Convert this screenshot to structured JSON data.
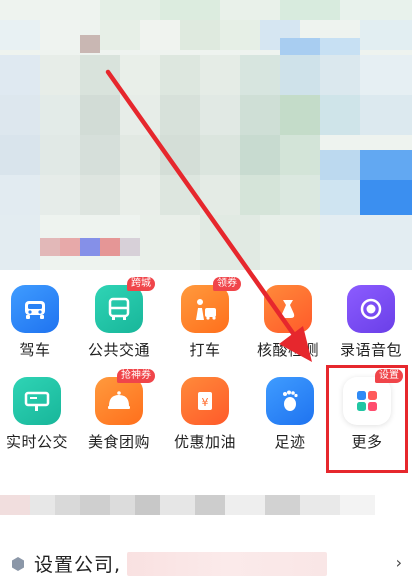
{
  "services": [
    {
      "id": "driving",
      "label": "驾车",
      "icon": "car-icon",
      "badge": ""
    },
    {
      "id": "transit",
      "label": "公共交通",
      "icon": "bus-icon",
      "badge": "跨城"
    },
    {
      "id": "taxi",
      "label": "打车",
      "icon": "taxi-person-icon",
      "badge": "领券"
    },
    {
      "id": "covid-test",
      "label": "核酸检测",
      "icon": "test-tube-icon",
      "badge": ""
    },
    {
      "id": "voice",
      "label": "录语音包",
      "icon": "record-icon",
      "badge": ""
    },
    {
      "id": "realtime-bus",
      "label": "实时公交",
      "icon": "bus-stop-icon",
      "badge": ""
    },
    {
      "id": "food",
      "label": "美食团购",
      "icon": "food-cover-icon",
      "badge": "抢神券"
    },
    {
      "id": "fuel",
      "label": "优惠加油",
      "icon": "fuel-yen-icon",
      "badge": ""
    },
    {
      "id": "footprint",
      "label": "足迹",
      "icon": "footprint-icon",
      "badge": ""
    },
    {
      "id": "more",
      "label": "更多",
      "icon": "grid-more-icon",
      "badge": "设置"
    }
  ],
  "bottom_row": {
    "company_label": "设置公司,",
    "hex_icon": "hexagon-icon",
    "chevron_icon": "chevron-right-icon"
  },
  "colors": {
    "highlight": "#e6272d",
    "arrow": "#e6272d",
    "badge": "#f0454a"
  }
}
